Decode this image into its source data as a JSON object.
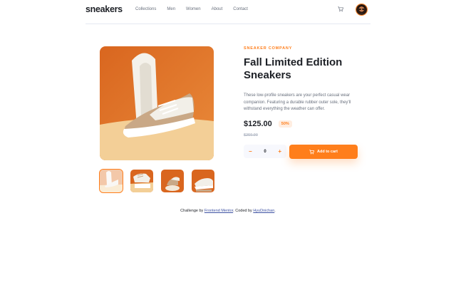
{
  "header": {
    "logo": "sneakers",
    "nav": [
      "Collections",
      "Men",
      "Women",
      "About",
      "Contact"
    ]
  },
  "product": {
    "company": "SNEAKER COMPANY",
    "title": "Fall Limited Edition Sneakers",
    "description": "These low-profile sneakers are your perfect casual wear companion. Featuring a durable rubber outer sole, they'll withstand everything the weather can offer.",
    "price": "$125.00",
    "discount": "50%",
    "old_price": "$250.00",
    "quantity": "0",
    "minus": "−",
    "plus": "+",
    "add_to_cart": "Add to cart"
  },
  "footer": {
    "prefix": "Challenge by ",
    "fm": "Frontend Mentor",
    "mid": ". Coded by ",
    "author": "HyuDnichan",
    "suffix": "."
  },
  "colors": {
    "accent": "#ff7e1b",
    "accent_pale": "#ffede0",
    "dark": "#1d2026",
    "muted": "#69707d"
  },
  "icons": [
    "cart-icon",
    "avatar"
  ]
}
